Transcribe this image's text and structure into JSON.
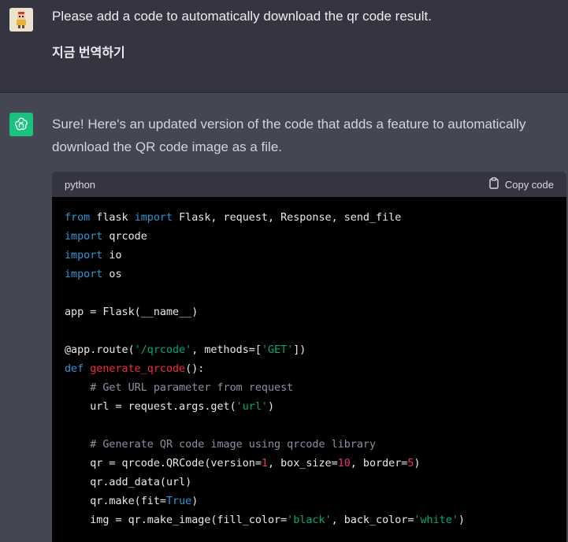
{
  "user_message": {
    "text": "Please add a code to automatically download the qr code result.",
    "translate_label": "지금 번역하기"
  },
  "assistant_message": {
    "text": "Sure! Here's an updated version of the code that adds a feature to automatically download the QR code image as a file."
  },
  "code_block": {
    "language": "python",
    "copy_label": "Copy code",
    "lines": [
      [
        {
          "t": "from",
          "c": "kw"
        },
        {
          "t": " flask "
        },
        {
          "t": "import",
          "c": "kw"
        },
        {
          "t": " Flask, request, Response, send_file"
        }
      ],
      [
        {
          "t": "import",
          "c": "kw"
        },
        {
          "t": " qrcode"
        }
      ],
      [
        {
          "t": "import",
          "c": "kw"
        },
        {
          "t": " io"
        }
      ],
      [
        {
          "t": "import",
          "c": "kw"
        },
        {
          "t": " os"
        }
      ],
      [],
      [
        {
          "t": "app = Flask(__name__)"
        }
      ],
      [],
      [
        {
          "t": "@app.route("
        },
        {
          "t": "'/qrcode'",
          "c": "str"
        },
        {
          "t": ", methods=["
        },
        {
          "t": "'GET'",
          "c": "str"
        },
        {
          "t": "])"
        }
      ],
      [
        {
          "t": "def",
          "c": "kw"
        },
        {
          "t": " "
        },
        {
          "t": "generate_qrcode",
          "c": "fn"
        },
        {
          "t": "():"
        }
      ],
      [
        {
          "t": "    "
        },
        {
          "t": "# Get URL parameter from request",
          "c": "cm"
        }
      ],
      [
        {
          "t": "    url = request.args.get("
        },
        {
          "t": "'url'",
          "c": "str"
        },
        {
          "t": ")"
        }
      ],
      [],
      [
        {
          "t": "    "
        },
        {
          "t": "# Generate QR code image using qrcode library",
          "c": "cm"
        }
      ],
      [
        {
          "t": "    qr = qrcode.QRCode(version="
        },
        {
          "t": "1",
          "c": "num"
        },
        {
          "t": ", box_size="
        },
        {
          "t": "10",
          "c": "num"
        },
        {
          "t": ", border="
        },
        {
          "t": "5",
          "c": "num"
        },
        {
          "t": ")"
        }
      ],
      [
        {
          "t": "    qr.add_data(url)"
        }
      ],
      [
        {
          "t": "    qr.make(fit="
        },
        {
          "t": "True",
          "c": "kw"
        },
        {
          "t": ")"
        }
      ],
      [
        {
          "t": "    img = qr.make_image(fill_color="
        },
        {
          "t": "'black'",
          "c": "str"
        },
        {
          "t": ", back_color="
        },
        {
          "t": "'white'",
          "c": "str"
        },
        {
          "t": ")"
        }
      ]
    ]
  },
  "icons": {
    "user_avatar": "user-avatar-icon",
    "assistant_avatar": "openai-logo-icon",
    "copy": "clipboard-icon"
  },
  "colors": {
    "user_bg": "#343541",
    "assistant_bg": "#444654",
    "code_bg": "#000000",
    "keyword": "#2e95d3",
    "function": "#f22c3d",
    "string": "#00a67d",
    "number": "#df3079",
    "comment": "#8e8ea0"
  }
}
